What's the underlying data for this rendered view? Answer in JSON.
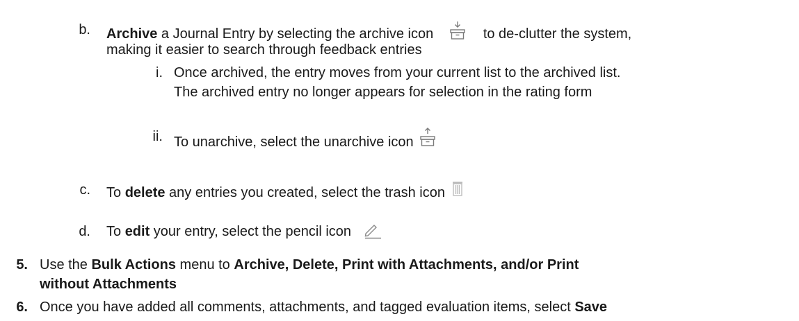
{
  "items": {
    "b": {
      "marker": "b.",
      "bold": "Archive",
      "text_before_icon": " a Journal Entry by selecting the archive icon",
      "text_after_icon": "to de-clutter the system,",
      "text_line2": "making it easier to search through feedback entries",
      "icon": "archive-icon"
    },
    "b_i": {
      "marker": "i.",
      "text_line1": "Once archived, the entry moves from your current list to the archived list.",
      "text_line2": "The archived entry no longer appears for selection in the rating form"
    },
    "b_ii": {
      "marker": "ii.",
      "text": "To unarchive, select the unarchive icon",
      "icon": "unarchive-icon"
    },
    "c": {
      "marker": "c.",
      "text_before": "To ",
      "bold": "delete",
      "text_after": " any entries you created, select the trash icon",
      "icon": "trash-icon"
    },
    "d": {
      "marker": "d.",
      "text_before": "To ",
      "bold": "edit",
      "text_after": " your entry, select the pencil icon",
      "icon": "pencil-icon"
    },
    "five": {
      "marker": "5.",
      "text_before": "Use the ",
      "bold1": "Bulk Actions",
      "text_mid": " menu to ",
      "bold2": "Archive, Delete, Print with Attachments, and/or Print",
      "bold3": "without Attachments"
    },
    "six": {
      "marker": "6.",
      "text": "Once you have added all comments, attachments, and tagged evaluation items, select ",
      "bold": "Save"
    }
  }
}
